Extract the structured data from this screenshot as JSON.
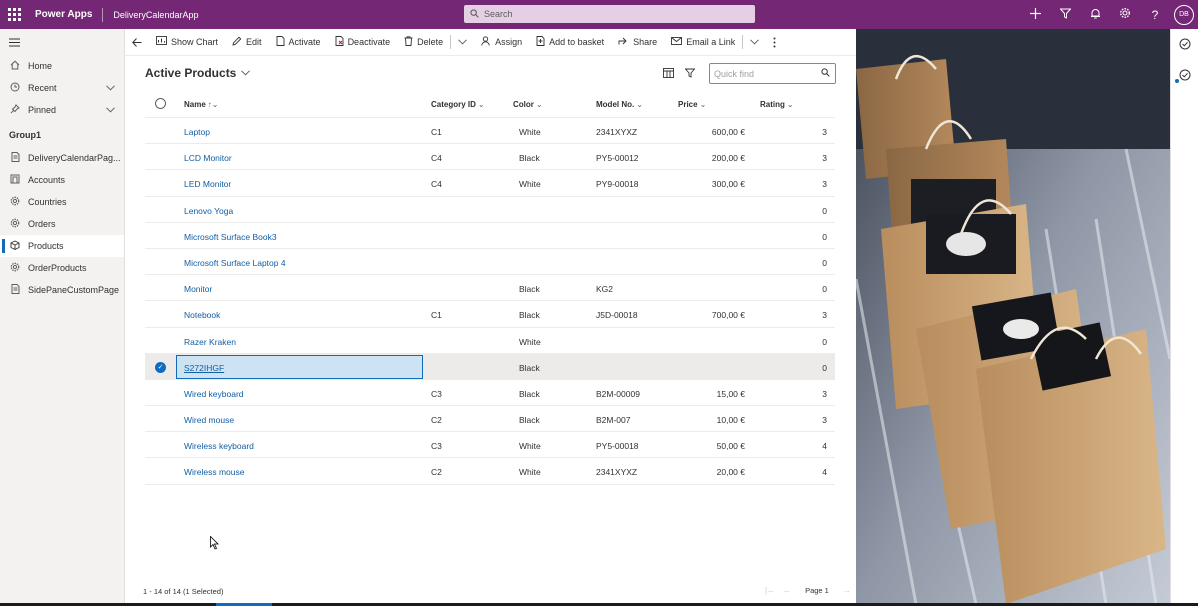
{
  "topbar": {
    "brand": "Power Apps",
    "app_name": "DeliveryCalendarApp",
    "search_placeholder": "Search",
    "avatar_initials": "DB",
    "icons": [
      "plus-icon",
      "filter-icon",
      "bell-icon",
      "gear-icon",
      "help-icon"
    ]
  },
  "nav": {
    "home": "Home",
    "recent": "Recent",
    "pinned": "Pinned",
    "group": "Group1",
    "items": [
      {
        "label": "DeliveryCalendarPag...",
        "icon": "page-icon"
      },
      {
        "label": "Accounts",
        "icon": "accounts-icon"
      },
      {
        "label": "Countries",
        "icon": "gear-icon"
      },
      {
        "label": "Orders",
        "icon": "gear-icon"
      },
      {
        "label": "Products",
        "icon": "cube-icon"
      },
      {
        "label": "OrderProducts",
        "icon": "gear-icon"
      },
      {
        "label": "SidePaneCustomPage",
        "icon": "page-icon"
      }
    ]
  },
  "commands": {
    "show_chart": "Show Chart",
    "edit": "Edit",
    "activate": "Activate",
    "deactivate": "Deactivate",
    "delete": "Delete",
    "assign": "Assign",
    "add_to_basket": "Add to basket",
    "share": "Share",
    "email_link": "Email a Link"
  },
  "view": {
    "title": "Active Products",
    "quick_find_placeholder": "Quick find"
  },
  "grid": {
    "headers": {
      "name": "Name",
      "category": "Category ID",
      "color": "Color",
      "model": "Model No.",
      "price": "Price",
      "rating": "Rating"
    },
    "rows": [
      {
        "name": "Laptop",
        "category": "C1",
        "color": "White",
        "model": "2341XYXZ",
        "price": "600,00 €",
        "rating": "3"
      },
      {
        "name": "LCD Monitor",
        "category": "C4",
        "color": "Black",
        "model": "PY5-00012",
        "price": "200,00 €",
        "rating": "3"
      },
      {
        "name": "LED Monitor",
        "category": "C4",
        "color": "White",
        "model": "PY9-00018",
        "price": "300,00 €",
        "rating": "3"
      },
      {
        "name": "Lenovo Yoga",
        "category": "",
        "color": "",
        "model": "",
        "price": "",
        "rating": "0"
      },
      {
        "name": "Microsoft Surface Book3",
        "category": "",
        "color": "",
        "model": "",
        "price": "",
        "rating": "0"
      },
      {
        "name": "Microsoft Surface Laptop 4",
        "category": "",
        "color": "",
        "model": "",
        "price": "",
        "rating": "0"
      },
      {
        "name": "Monitor",
        "category": "",
        "color": "Black",
        "model": "KG2",
        "price": "",
        "rating": "0"
      },
      {
        "name": "Notebook",
        "category": "C1",
        "color": "Black",
        "model": "J5D-00018",
        "price": "700,00 €",
        "rating": "3"
      },
      {
        "name": "Razer Kraken",
        "category": "",
        "color": "White",
        "model": "",
        "price": "",
        "rating": "0"
      },
      {
        "name": "S272IHGF",
        "category": "",
        "color": "Black",
        "model": "",
        "price": "",
        "rating": "0",
        "selected": true
      },
      {
        "name": "Wired keyboard",
        "category": "C3",
        "color": "Black",
        "model": "B2M-00009",
        "price": "15,00 €",
        "rating": "3"
      },
      {
        "name": "Wired mouse",
        "category": "C2",
        "color": "Black",
        "model": "B2M-007",
        "price": "10,00 €",
        "rating": "3"
      },
      {
        "name": "Wireless keyboard",
        "category": "C3",
        "color": "White",
        "model": "PY5-00018",
        "price": "50,00 €",
        "rating": "4"
      },
      {
        "name": "Wireless mouse",
        "category": "C2",
        "color": "White",
        "model": "2341XYXZ",
        "price": "20,00 €",
        "rating": "4"
      }
    ]
  },
  "footer": {
    "count": "1 - 14 of 14 (1 Selected)",
    "page": "Page 1"
  },
  "colors": {
    "topbar": "#742774",
    "accent": "#0f6cbd",
    "link": "#115ea3"
  }
}
